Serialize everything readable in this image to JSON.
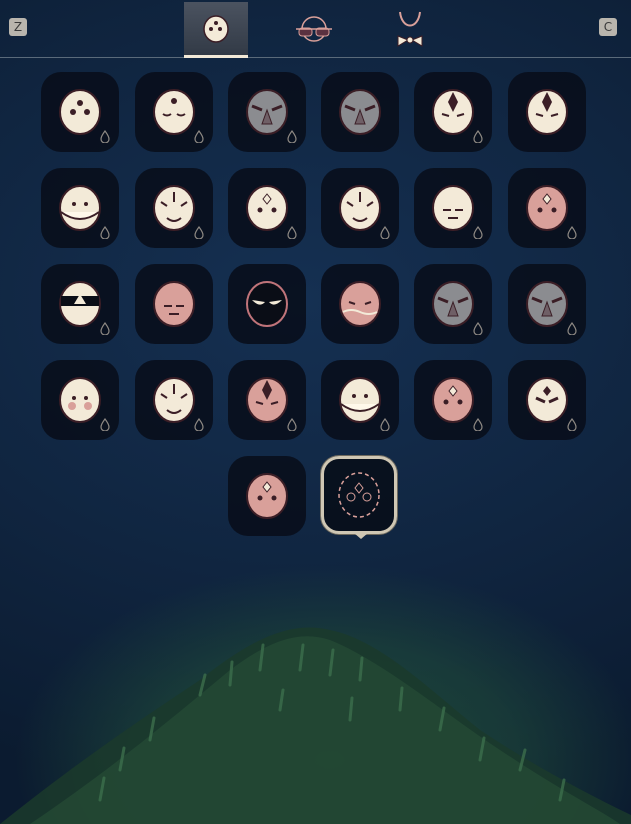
{
  "keys": {
    "left": "Z",
    "right": "C"
  },
  "tabs": [
    {
      "name": "mask-tab",
      "icon": "mask-icon",
      "active": true
    },
    {
      "name": "hair-tab",
      "icon": "glasses-icon",
      "active": false
    },
    {
      "name": "cape-tab",
      "icon": "necklace-icon",
      "active": false
    }
  ],
  "colors": {
    "cream": "#f3ead8",
    "pink": "#d9a09a",
    "grey": "#8b8c90",
    "outline": "#3b1e26",
    "slot": "#080e1a"
  },
  "masks": [
    {
      "icon": "dotted-mask-icon",
      "fill": "cream",
      "drop": true
    },
    {
      "icon": "sleepy-sparkle-mask-icon",
      "fill": "cream",
      "drop": true
    },
    {
      "icon": "hooded-mask-icon",
      "fill": "grey",
      "drop": true
    },
    {
      "icon": "horned-demon-mask-icon",
      "fill": "grey",
      "drop": false
    },
    {
      "icon": "tall-oni-mask-icon",
      "fill": "cream",
      "drop": true
    },
    {
      "icon": "crested-mask-icon",
      "fill": "cream",
      "drop": false
    },
    {
      "icon": "bandana-mask-icon",
      "fill": "cream",
      "drop": true
    },
    {
      "icon": "owl-mask-icon",
      "fill": "cream",
      "drop": true
    },
    {
      "icon": "diamond-bird-mask-icon",
      "fill": "cream",
      "drop": true
    },
    {
      "icon": "feather-crown-mask-icon",
      "fill": "cream",
      "drop": true
    },
    {
      "icon": "plain-mask-icon",
      "fill": "cream",
      "drop": true
    },
    {
      "icon": "pink-gem-mask-icon",
      "fill": "pink",
      "drop": true
    },
    {
      "icon": "visor-mask-icon",
      "fill": "cream",
      "drop": true
    },
    {
      "icon": "calm-pink-mask-icon",
      "fill": "pink",
      "drop": false
    },
    {
      "icon": "dark-eyes-mask-icon",
      "fill": "outline",
      "drop": false
    },
    {
      "icon": "wavy-pink-mask-icon",
      "fill": "pink",
      "drop": false
    },
    {
      "icon": "beaked-grey-mask-icon",
      "fill": "grey",
      "drop": true
    },
    {
      "icon": "vulture-mask-icon",
      "fill": "grey",
      "drop": true
    },
    {
      "icon": "blush-mask-icon",
      "fill": "cream",
      "drop": true
    },
    {
      "icon": "tiger-mask-icon",
      "fill": "cream",
      "drop": true
    },
    {
      "icon": "antler-mask-icon",
      "fill": "pink",
      "drop": true
    },
    {
      "icon": "flower-mask-icon",
      "fill": "cream",
      "drop": true
    },
    {
      "icon": "star-pink-mask-icon",
      "fill": "pink",
      "drop": true
    },
    {
      "icon": "angry-mask-icon",
      "fill": "cream",
      "drop": true
    },
    {
      "icon": "spotted-pink-mask-icon",
      "fill": "pink",
      "drop": false
    },
    {
      "icon": "no-mask-icon",
      "fill": "outline",
      "drop": false,
      "selected": true
    }
  ]
}
